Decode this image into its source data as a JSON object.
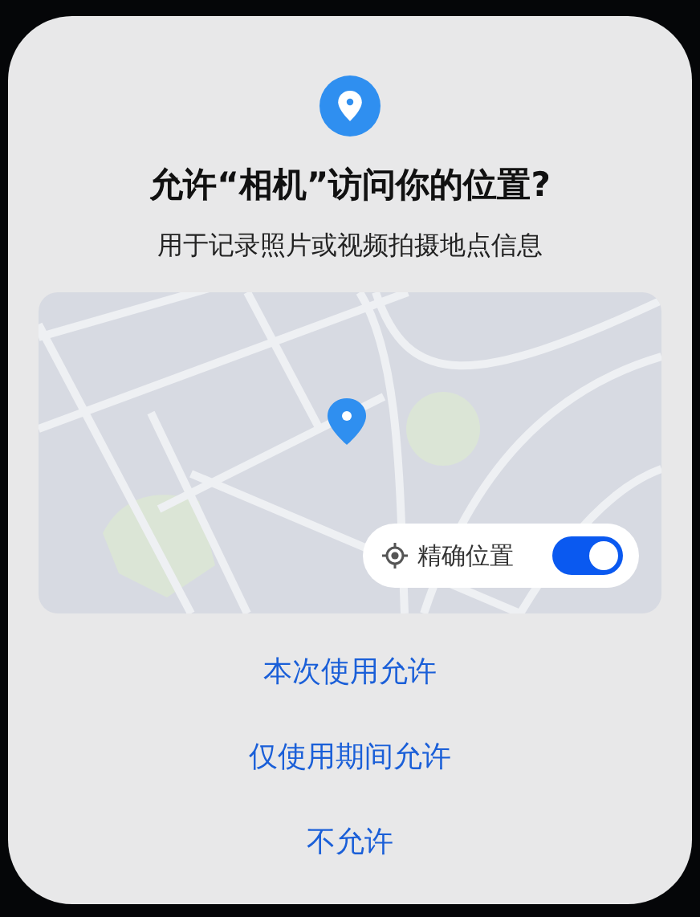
{
  "dialog": {
    "title": "允许“相机”访问你的位置?",
    "message": "用于记录照片或视频拍摄地点信息",
    "precise_location": {
      "label": "精确位置",
      "on": true
    },
    "buttons": [
      {
        "label": "本次使用允许"
      },
      {
        "label": "仅使用期间允许"
      },
      {
        "label": "不允许"
      }
    ]
  }
}
